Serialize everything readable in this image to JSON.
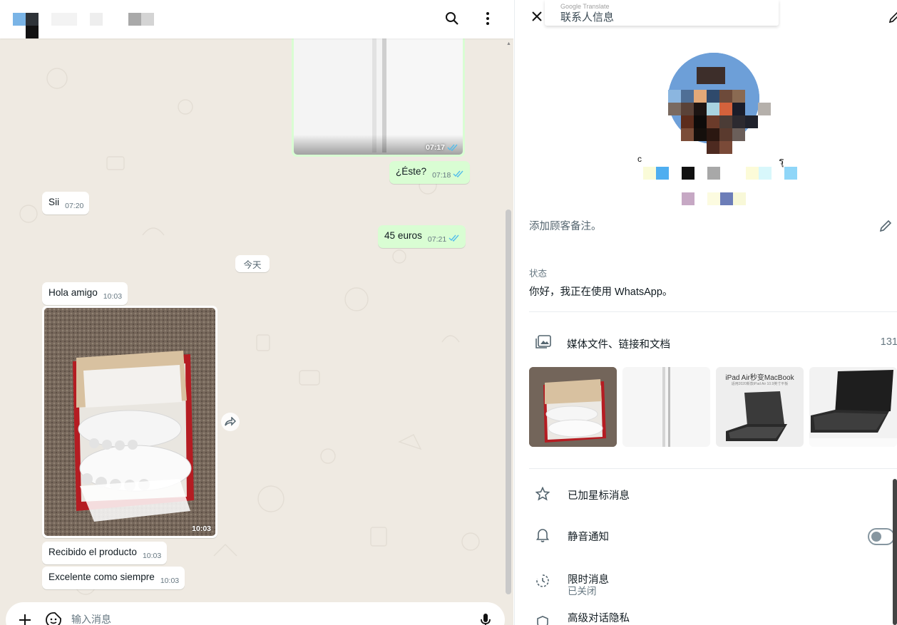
{
  "chat": {
    "messages": [
      {
        "side": "out",
        "time": "07:17"
      },
      {
        "side": "out",
        "text": "¿Éste?",
        "time": "07:18"
      },
      {
        "side": "in",
        "text": "Sii",
        "time": "07:20"
      },
      {
        "side": "out",
        "text": "45 euros",
        "time": "07:21"
      },
      {
        "side": "in",
        "text": "Hola amigo",
        "time": "10:03"
      },
      {
        "side": "in",
        "time": "10:03"
      },
      {
        "side": "in",
        "text": "Recibido el producto",
        "time": "10:03"
      },
      {
        "side": "in",
        "text": "Excelente como siempre",
        "time": "10:03"
      }
    ],
    "day_separator": "今天",
    "composer": {
      "placeholder": "输入消息"
    }
  },
  "contact_info": {
    "google_translate_label": "Google Translate",
    "title": "联系人信息",
    "name_fragments": {
      "left": "c",
      "right": "รุ"
    },
    "note_placeholder": "添加顾客备注。",
    "status_label": "状态",
    "status_text": "你好，我正在使用 WhatsApp。",
    "media": {
      "label": "媒体文件、链接和文档",
      "count": "131",
      "thumb_3_title": "iPad Air秒变MacBook",
      "thumb_3_sub": "适用2020新款iPad Air 10.9英寸平板"
    },
    "menu": {
      "starred": "已加星标消息",
      "mute": "静音通知",
      "mute_enabled": false,
      "disappearing": "限时消息",
      "disappearing_status": "已关闭",
      "privacy": "高级对话隐私"
    }
  },
  "colors": {
    "outgoing_bubble": "#d9fdd3",
    "incoming_bubble": "#ffffff",
    "chat_background": "#efeae2",
    "read_ticks": "#53bdeb"
  },
  "icons": [
    "search-icon",
    "menu-icon",
    "forward-icon",
    "plus-icon",
    "sticker-icon",
    "mic-icon",
    "close-icon",
    "pencil-icon",
    "media-icon",
    "star-icon",
    "bell-icon",
    "timer-icon",
    "shield-icon"
  ]
}
